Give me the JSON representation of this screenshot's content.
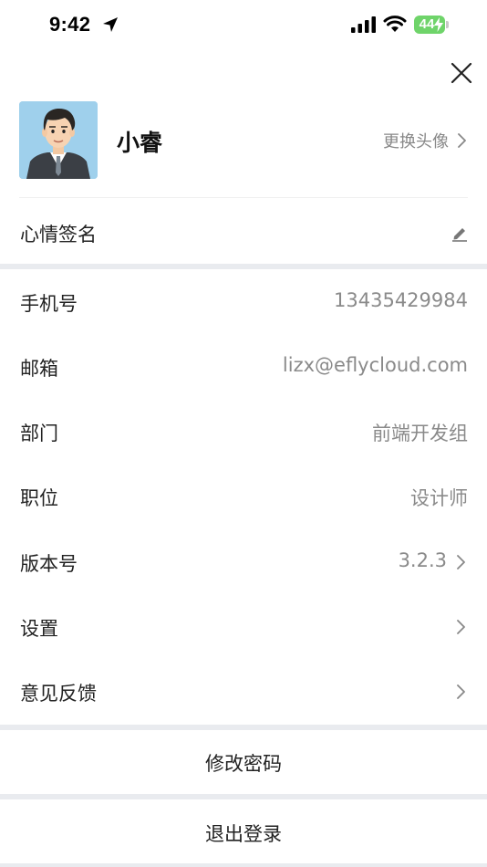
{
  "status_bar": {
    "time": "9:42",
    "battery_level": "44"
  },
  "profile": {
    "name": "小睿",
    "change_avatar_label": "更换头像"
  },
  "mood": {
    "label": "心情签名"
  },
  "info": {
    "phone_label": "手机号",
    "phone_value": "13435429984",
    "email_label": "邮箱",
    "email_value": "lizx@eflycloud.com",
    "department_label": "部门",
    "department_value": "前端开发组",
    "position_label": "职位",
    "position_value": "设计师",
    "version_label": "版本号",
    "version_value": "3.2.3",
    "settings_label": "设置",
    "feedback_label": "意见反馈"
  },
  "actions": {
    "change_password": "修改密码",
    "logout": "退出登录"
  },
  "colors": {
    "background": "#ffffff",
    "section_gap": "#e9ebef",
    "secondary_text": "#8a8a8a",
    "battery": "#6fd46a"
  }
}
